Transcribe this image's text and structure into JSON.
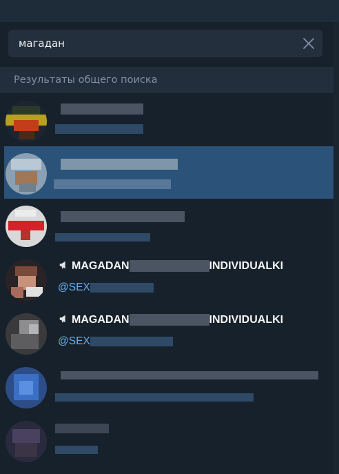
{
  "search": {
    "value": "магадан"
  },
  "section_title": "Результаты общего поиска",
  "results": [
    {
      "title": "",
      "subtitle": ""
    },
    {
      "title": "",
      "subtitle": ""
    },
    {
      "title": "",
      "subtitle": ""
    },
    {
      "title_start": "MAGADAN",
      "title_end": "INDIVIDUALKI",
      "subtitle": "@SEX",
      "icon": "megaphone-icon"
    },
    {
      "title_start": "MAGADAN",
      "title_end": "INDIVIDUALKI",
      "subtitle": "@SEX",
      "icon": "megaphone-icon"
    },
    {
      "title": "",
      "subtitle": ""
    },
    {
      "title": "",
      "subtitle": ""
    }
  ],
  "colors": {
    "background": "#17212b",
    "selected": "#2b5278",
    "link": "#6ab2f2",
    "section": "#232e3c"
  }
}
